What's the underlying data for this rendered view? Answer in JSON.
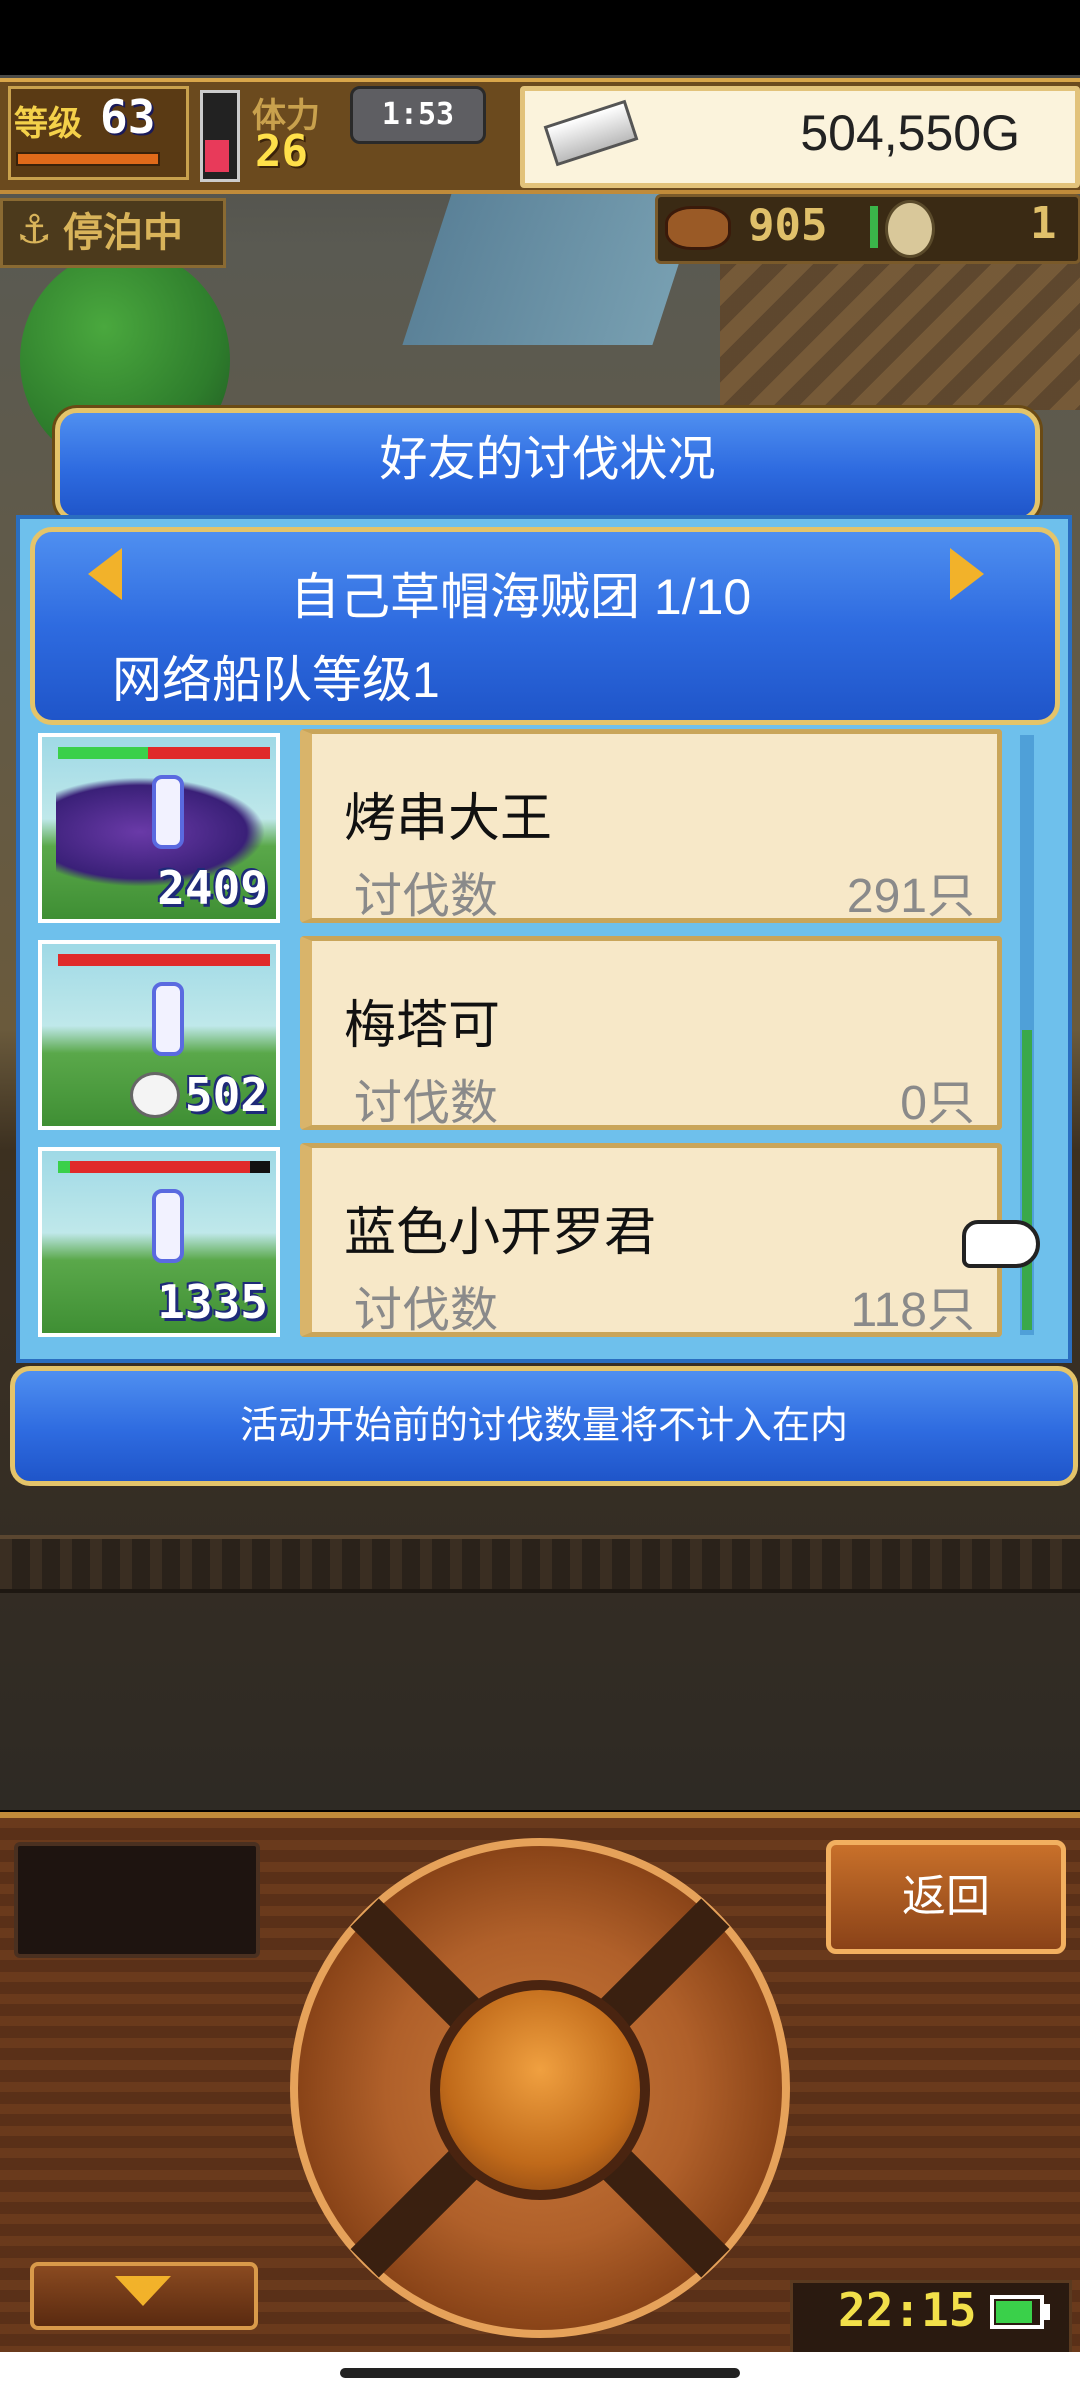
{
  "hud": {
    "level_label": "等级",
    "level": "63",
    "stamina_label": "体力",
    "stamina": "26",
    "timer": "1:53",
    "gold": "504,550G",
    "dock_status": "停泊中",
    "meat": "905",
    "coins": "1"
  },
  "dialog": {
    "title": "好友的讨伐状况",
    "team": "自己草帽海贼团 1/10",
    "fleet_level": "网络船队等级1",
    "rows": [
      {
        "name": "烤串大王",
        "label": "讨伐数",
        "value": "291只",
        "kills": "2409"
      },
      {
        "name": "梅塔可",
        "label": "讨伐数",
        "value": "0只",
        "kills": "502"
      },
      {
        "name": "蓝色小开罗君",
        "label": "讨伐数",
        "value": "118只",
        "kills": "1335"
      }
    ],
    "notice": "活动开始前的讨伐数量将不计入在内"
  },
  "controls": {
    "back": "返回",
    "clock": "22:15"
  },
  "colors": {
    "dialog_blue": "#2e6be0",
    "gold_border": "#e4c46a",
    "card_bg": "#f7e8c8"
  }
}
